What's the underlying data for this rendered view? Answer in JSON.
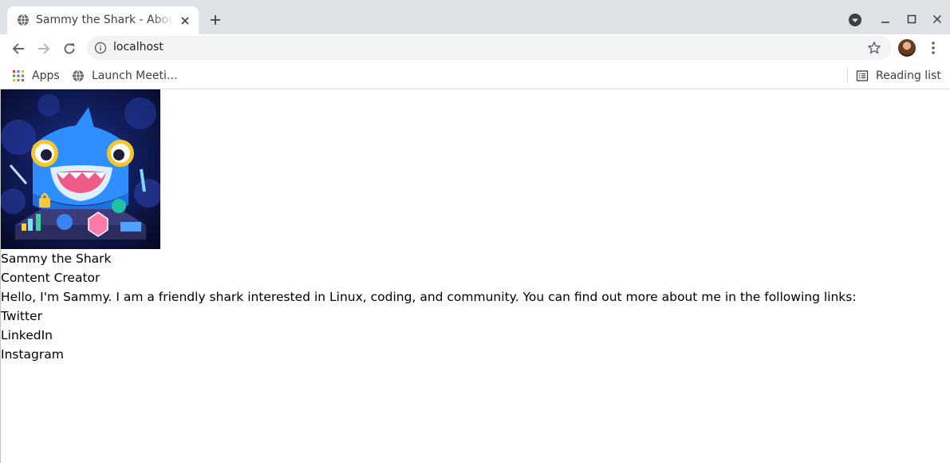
{
  "browser": {
    "tab": {
      "title": "Sammy the Shark - About me"
    },
    "omnibox": {
      "url": "localhost"
    },
    "bookmarks": [
      {
        "label": "Apps",
        "icon": "apps-grid-icon"
      },
      {
        "label": "Launch Meeti…",
        "icon": "globe-icon"
      }
    ],
    "reading_list": {
      "label": "Reading list",
      "icon": "reading-list-icon"
    }
  },
  "page": {
    "name": "Sammy the Shark",
    "role": "Content Creator",
    "bio": "Hello, I'm Sammy. I am a friendly shark interested in Linux, coding, and community. You can find out more about me in the following links:",
    "links": [
      {
        "label": "Twitter"
      },
      {
        "label": "LinkedIn"
      },
      {
        "label": "Instagram"
      }
    ]
  },
  "colors": {
    "tabstrip_bg": "#dee1e6",
    "omnibox_bg": "#f1f3f4",
    "icon_gray": "#5f6368"
  }
}
